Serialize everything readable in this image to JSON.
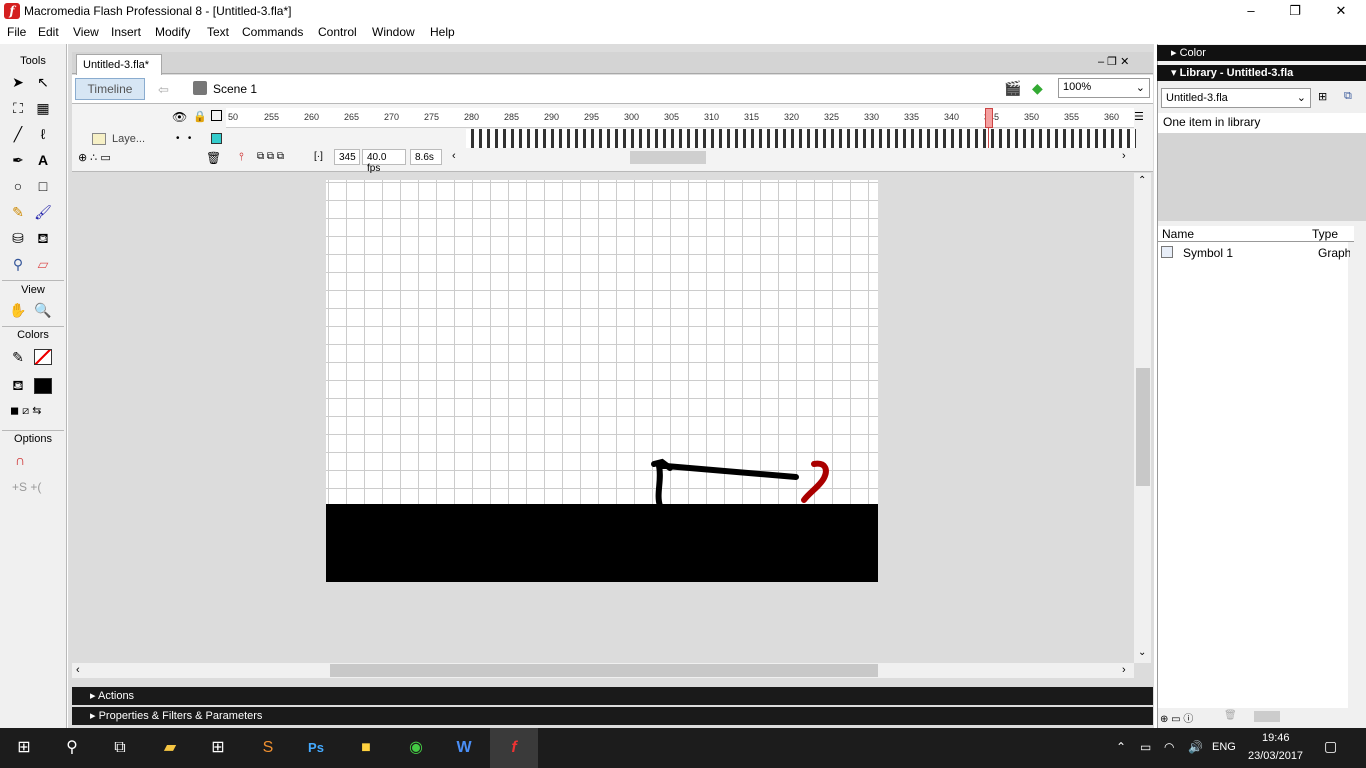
{
  "window": {
    "title": "Macromedia Flash Professional 8 - [Untitled-3.fla*]",
    "minimize": "–",
    "maximize": "❐",
    "close": "✕"
  },
  "menu": [
    "File",
    "Edit",
    "View",
    "Insert",
    "Modify",
    "Text",
    "Commands",
    "Control",
    "Window",
    "Help"
  ],
  "tools": {
    "header": "Tools",
    "view": "View",
    "colors": "Colors",
    "options": "Options"
  },
  "document": {
    "tab": "Untitled-3.fla*",
    "timeline_button": "Timeline",
    "scene": "Scene 1",
    "zoom": "100%"
  },
  "timeline": {
    "ruler": [
      "50",
      "255",
      "260",
      "265",
      "270",
      "275",
      "280",
      "285",
      "290",
      "295",
      "300",
      "305",
      "310",
      "315",
      "320",
      "325",
      "330",
      "335",
      "340",
      "345",
      "350",
      "355",
      "360"
    ],
    "layer": "Laye...",
    "current_frame": "345",
    "fps": "40.0 fps",
    "time": "8.6s"
  },
  "panels": {
    "actions": "Actions",
    "properties": "Properties & Filters & Parameters"
  },
  "right": {
    "color": "Color",
    "library_title": "Library - Untitled-3.fla",
    "library_doc": "Untitled-3.fla",
    "count": "One item in library",
    "col_name": "Name",
    "col_type": "Type",
    "items": [
      {
        "name": "Symbol 1",
        "type": "Graph"
      }
    ]
  },
  "taskbar": {
    "lang": "ENG",
    "time": "19:46",
    "date": "23/03/2017"
  }
}
